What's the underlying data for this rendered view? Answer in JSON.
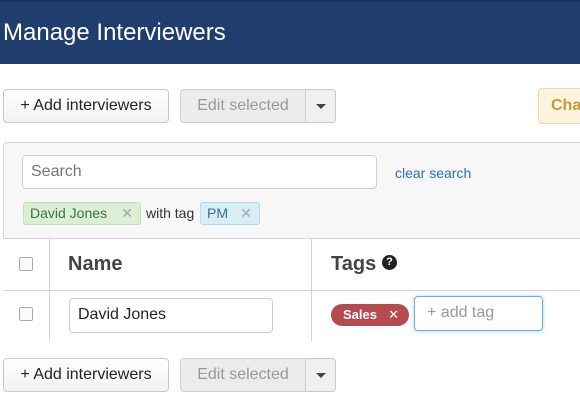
{
  "header": {
    "title": "Manage Interviewers"
  },
  "toolbar": {
    "add_label": "+ Add interviewers",
    "edit_label": "Edit selected",
    "cha_label": "Cha"
  },
  "filter": {
    "search_placeholder": "Search",
    "clear_label": "clear search",
    "chip_person": "David Jones",
    "with_tag_label": "with tag",
    "chip_tag": "PM",
    "remove_glyph": "✕"
  },
  "table": {
    "columns": [
      "Name",
      "Tags"
    ],
    "rows": [
      {
        "name": "David Jones",
        "tag": "Sales",
        "tag_input_placeholder": "+ add tag"
      }
    ]
  },
  "icons": {
    "help": "question-circle-icon",
    "caret": "caret-down-icon"
  }
}
